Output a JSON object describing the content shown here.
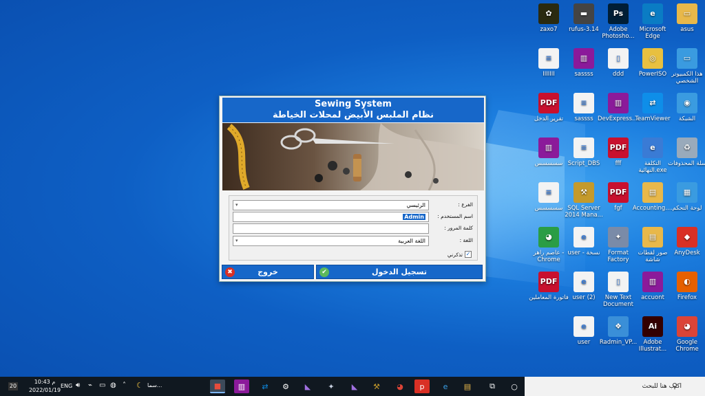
{
  "desktop_icons": [
    {
      "id": "zaxo7",
      "label": "zaxo7",
      "glyph": "✿",
      "color": "#2a2a10"
    },
    {
      "id": "rufus",
      "label": "rufus-3.14",
      "glyph": "▬",
      "color": "#444"
    },
    {
      "id": "photoshop",
      "label": "Adobe Photosho...",
      "glyph": "Ps",
      "color": "#001e36"
    },
    {
      "id": "edge",
      "label": "Microsoft Edge",
      "glyph": "e",
      "color": "#0a7cc4"
    },
    {
      "id": "asus",
      "label": "asus",
      "glyph": "▭",
      "color": "#e8b84a"
    },
    {
      "id": "IIIIIII",
      "label": "IIIIIII",
      "glyph": "≡",
      "color": "#f3f3f3"
    },
    {
      "id": "sassss1",
      "label": "sassss",
      "glyph": "▥",
      "color": "#8b1a9a"
    },
    {
      "id": "ddd",
      "label": "ddd",
      "glyph": "▯",
      "color": "#f3f3f3"
    },
    {
      "id": "poweriso",
      "label": "PowerISO",
      "glyph": "◎",
      "color": "#e8c040"
    },
    {
      "id": "thispc",
      "label": "هذا الكمبيوتر الشخصي",
      "glyph": "▭",
      "color": "#3a9be0"
    },
    {
      "id": "pdf-income",
      "label": "تقرير الدخل",
      "glyph": "PDF",
      "color": "#c8102e"
    },
    {
      "id": "sassss2",
      "label": "sassss",
      "glyph": "≡",
      "color": "#f3f3f3"
    },
    {
      "id": "devexpress",
      "label": "DevExpress....",
      "glyph": "▥",
      "color": "#8b1a9a"
    },
    {
      "id": "teamviewer",
      "label": "TeamViewer",
      "glyph": "⇄",
      "color": "#0e8ee9"
    },
    {
      "id": "network",
      "label": "الشبكة",
      "glyph": "◉",
      "color": "#3a9be0"
    },
    {
      "id": "rar-arabic1",
      "label": "سسسسس",
      "glyph": "▥",
      "color": "#8b1a9a"
    },
    {
      "id": "script-dbs",
      "label": "Script_DBS",
      "glyph": "≡",
      "color": "#f3f3f3"
    },
    {
      "id": "fff",
      "label": "fff",
      "glyph": "PDF",
      "color": "#c8102e"
    },
    {
      "id": "final-cost",
      "label": "التكلفة النهائية.exe",
      "glyph": "e",
      "color": "#3a7bd5"
    },
    {
      "id": "recycle",
      "label": "سلة المحذوفات",
      "glyph": "♻",
      "color": "#9ab"
    },
    {
      "id": "txt-arabic",
      "label": "سسسسس",
      "glyph": "≡",
      "color": "#f3f3f3"
    },
    {
      "id": "sqlserver",
      "label": "SQL Server 2014 Mana...",
      "glyph": "⚒",
      "color": "#c49a2c"
    },
    {
      "id": "fgf",
      "label": "fgf",
      "glyph": "PDF",
      "color": "#c8102e"
    },
    {
      "id": "accounting",
      "label": "Accounting....",
      "glyph": "▤",
      "color": "#e8b84a"
    },
    {
      "id": "controlpanel",
      "label": "لوحة التحكم",
      "glyph": "▦",
      "color": "#3a9be0"
    },
    {
      "id": "chrome-asem",
      "label": "عاصم راهر - Chrome",
      "glyph": "◕",
      "color": "#2a9d45"
    },
    {
      "id": "user-copy",
      "label": "user - نسخة",
      "glyph": "e",
      "color": "#f3f3f3"
    },
    {
      "id": "format-factory",
      "label": "Format Factory",
      "glyph": "✦",
      "color": "#7a8ba8"
    },
    {
      "id": "screenshots",
      "label": "صور لقطات شاشة",
      "glyph": "▤",
      "color": "#e8b84a"
    },
    {
      "id": "anydesk",
      "label": "AnyDesk",
      "glyph": "◆",
      "color": "#d93025"
    },
    {
      "id": "pdf-invoice",
      "label": "فاتورة المعاملين",
      "glyph": "PDF",
      "color": "#c8102e"
    },
    {
      "id": "user2",
      "label": "user (2)",
      "glyph": "e",
      "color": "#f3f3f3"
    },
    {
      "id": "newtext",
      "label": "New Text Document",
      "glyph": "▯",
      "color": "#f3f3f3"
    },
    {
      "id": "accuont",
      "label": "accuont",
      "glyph": "▥",
      "color": "#8b1a9a"
    },
    {
      "id": "firefox",
      "label": "Firefox",
      "glyph": "◐",
      "color": "#e66000"
    },
    {
      "id": "user",
      "label": "user",
      "glyph": "e",
      "color": "#f3f3f3"
    },
    {
      "id": "radmin",
      "label": "Radmin_VP...",
      "glyph": "❖",
      "color": "#3a8fd8"
    },
    {
      "id": "illustrator",
      "label": "Adobe Illustrat...",
      "glyph": "Ai",
      "color": "#330000"
    },
    {
      "id": "chrome",
      "label": "Google Chrome",
      "glyph": "◕",
      "color": "#db4437"
    }
  ],
  "dialog": {
    "title_en": "Sewing System",
    "title_ar": "نظام الملبس الأبيض لمحلات الخياطة",
    "branch_label": "الفرع :",
    "branch_value": "الرئيسي",
    "username_label": "اسم المستخدم :",
    "username_value": "Admin",
    "password_label": "كلمة المرور :",
    "password_value": "",
    "language_label": "اللغة :",
    "language_value": "اللغة العربية",
    "remember_label": "تذكرني",
    "remember_checked": "✓",
    "login_label": "تسجيل الدخول",
    "exit_label": "خروج",
    "dropdown_caret": "▾",
    "login_icon": "✔",
    "exit_icon": "✖"
  },
  "taskbar": {
    "search_placeholder": "اكتب هنا للبحث",
    "time": "10:43 م",
    "date": "2022/01/19",
    "lang": "ENG",
    "weather": "سما...",
    "notifications": "20",
    "search_icon": "⚲",
    "cortana_icon": "○",
    "taskview_icon": "⧉"
  }
}
